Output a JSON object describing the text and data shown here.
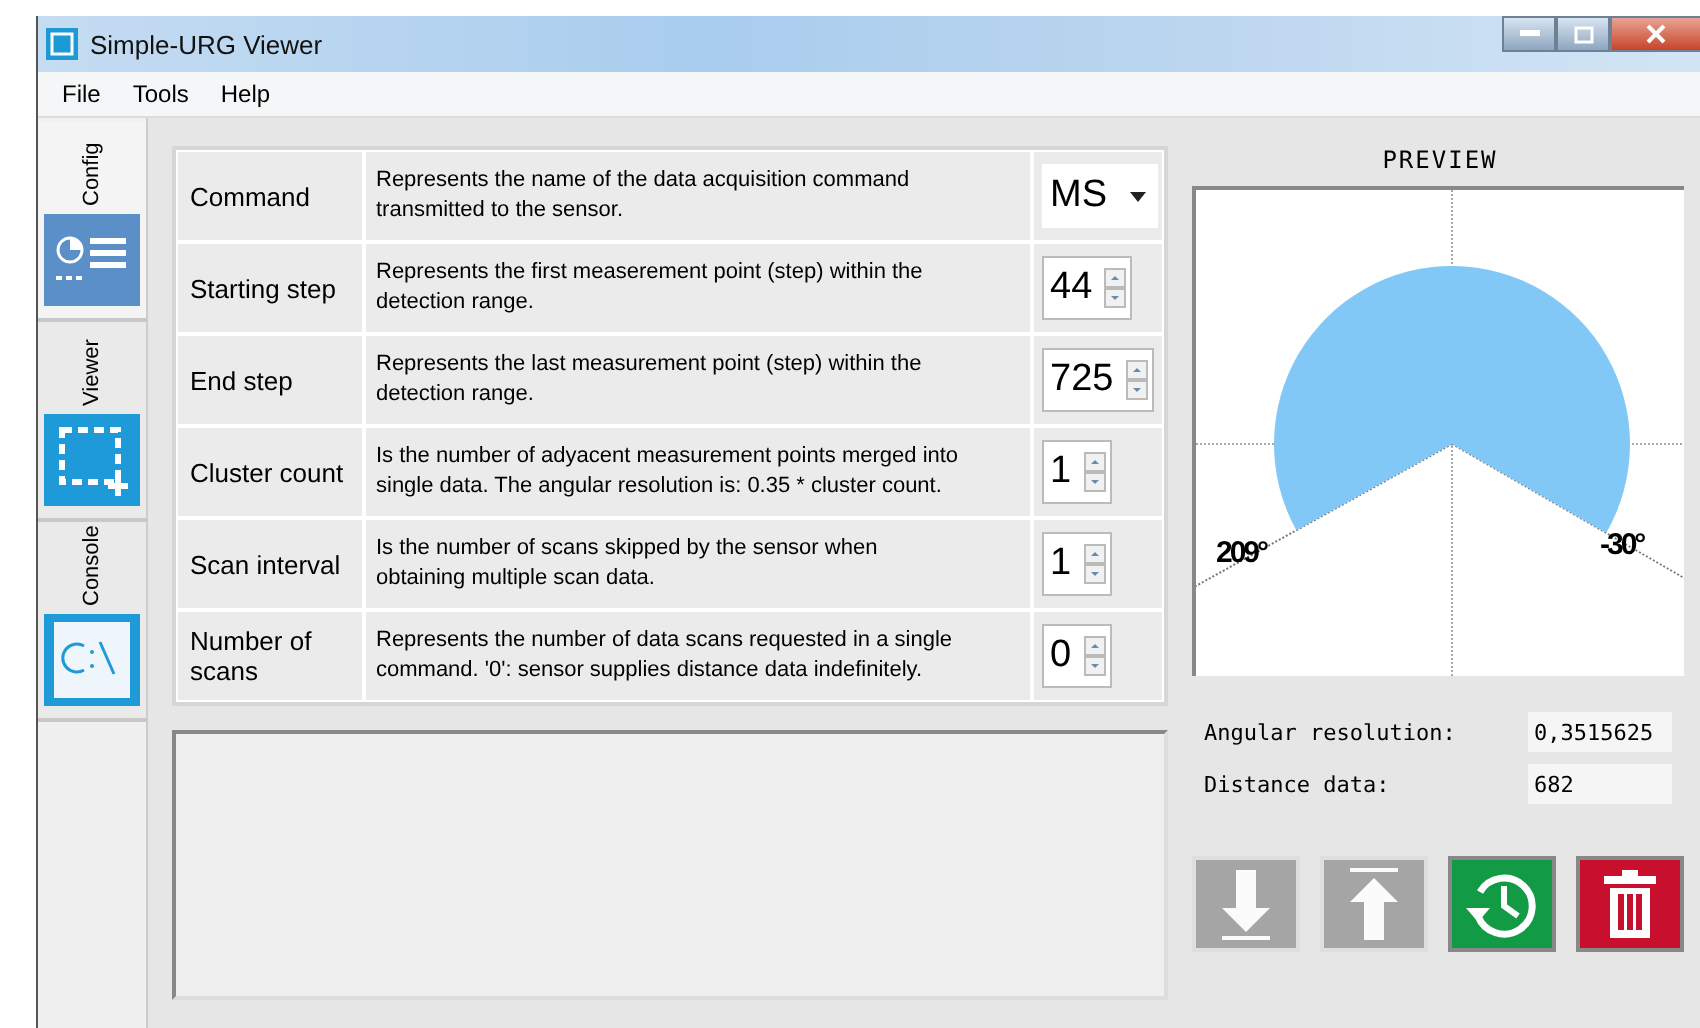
{
  "window": {
    "title": "Simple-URG Viewer"
  },
  "menu": [
    "File",
    "Tools",
    "Help"
  ],
  "tabs": [
    {
      "label": "Config",
      "kind": "config",
      "selected": true
    },
    {
      "label": "Viewer",
      "kind": "viewer",
      "selected": false
    },
    {
      "label": "Console",
      "kind": "console",
      "selected": false
    }
  ],
  "parameters": [
    {
      "label": "Command",
      "description": "Represents the name of the data acquisition command transmitted to the sensor.",
      "value": "MS",
      "kind": "dropdown"
    },
    {
      "label": "Starting step",
      "description": "Represents the first measerement point (step) within the detection range.",
      "value": "44",
      "kind": "spinner"
    },
    {
      "label": "End step",
      "description": "Represents the last measurement point (step) within the detection range.",
      "value": "725",
      "kind": "spinner"
    },
    {
      "label": "Cluster count",
      "description": "Is the number of adyacent measurement points merged into single data. The angular resolution is:  0.35 * cluster count.",
      "value": "1",
      "kind": "spinner"
    },
    {
      "label": "Scan interval",
      "description": "Is the number of scans skipped by the sensor when obtaining multiple scan data.",
      "value": "1",
      "kind": "spinner"
    },
    {
      "label": "Number of scans",
      "description": "Represents the number of data scans requested in a single command. '0': sensor supplies distance data indefinitely.",
      "value": "0",
      "kind": "spinner"
    }
  ],
  "preview": {
    "title": "PREVIEW",
    "start_angle": "209°",
    "end_angle": "-30°"
  },
  "readouts": [
    {
      "label": "Angular resolution:",
      "value": "0,3515625"
    },
    {
      "label": "Distance data:",
      "value": "682"
    }
  ],
  "actions": [
    {
      "kind": "download",
      "disabled": true
    },
    {
      "kind": "upload",
      "disabled": true
    },
    {
      "kind": "history",
      "disabled": false
    },
    {
      "kind": "delete",
      "disabled": false
    }
  ]
}
